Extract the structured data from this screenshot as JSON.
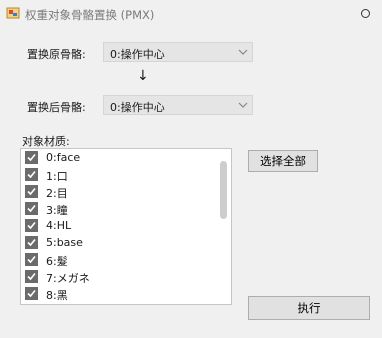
{
  "window": {
    "title": "权重对象骨骼置换 (PMX)",
    "icons": {
      "app": "app-icon",
      "window_button": "circle-icon"
    }
  },
  "source_bone": {
    "label": "置换原骨骼:",
    "selected": "0:操作中心"
  },
  "arrow_text": "↓",
  "target_bone": {
    "label": "置换后骨骼:",
    "selected": "0:操作中心"
  },
  "materials": {
    "label": "对象材质:",
    "items": [
      {
        "text": "0:face",
        "checked": true
      },
      {
        "text": "1:口",
        "checked": true
      },
      {
        "text": "2:目",
        "checked": true
      },
      {
        "text": "3:瞳",
        "checked": true
      },
      {
        "text": "4:HL",
        "checked": true
      },
      {
        "text": "5:base",
        "checked": true
      },
      {
        "text": "6:髮",
        "checked": true
      },
      {
        "text": "7:メガネ",
        "checked": true
      },
      {
        "text": "8:黑",
        "checked": true
      }
    ]
  },
  "buttons": {
    "select_all": "选择全部",
    "execute": "执行"
  },
  "colors": {
    "background": "#f0f0f0",
    "checkbox": "#6b6b6b",
    "combo": "#e5e5e5"
  }
}
